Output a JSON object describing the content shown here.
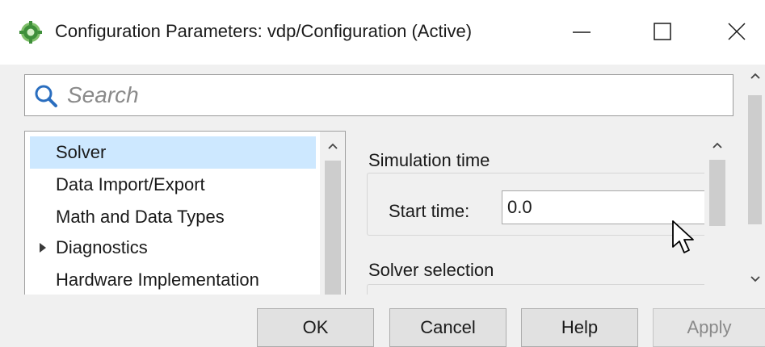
{
  "window": {
    "title": "Configuration Parameters: vdp/Configuration (Active)",
    "icon": "simulink-gear-icon"
  },
  "search": {
    "placeholder": "Search",
    "value": ""
  },
  "tree": {
    "items": [
      {
        "label": "Solver",
        "selected": true,
        "expandable": false
      },
      {
        "label": "Data Import/Export",
        "selected": false,
        "expandable": false
      },
      {
        "label": "Math and Data Types",
        "selected": false,
        "expandable": false
      },
      {
        "label": "Diagnostics",
        "selected": false,
        "expandable": true
      },
      {
        "label": "Hardware Implementation",
        "selected": false,
        "expandable": false
      }
    ]
  },
  "right_panel": {
    "simulation_time": {
      "title": "Simulation time",
      "start_time_label": "Start time:",
      "start_time_value": "0.0"
    },
    "solver_selection": {
      "title": "Solver selection"
    }
  },
  "buttons": {
    "ok": "OK",
    "cancel": "Cancel",
    "help": "Help",
    "apply": "Apply",
    "apply_enabled": false
  },
  "colors": {
    "selection": "#cde8ff",
    "dialog_bg": "#f0f0f0",
    "search_icon": "#2a6ebf"
  }
}
